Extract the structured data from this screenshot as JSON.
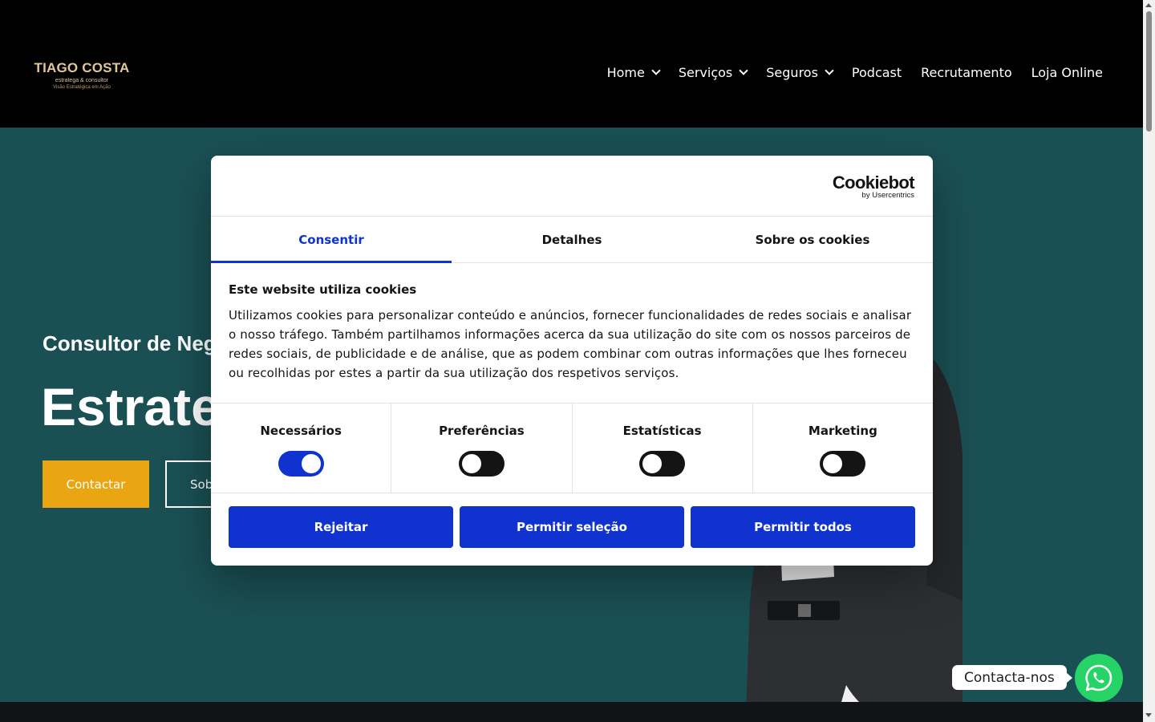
{
  "header": {
    "logo": {
      "name": "TIAGO COSTA",
      "subtitle": "estratega & consultor",
      "tagline": "Visão Estratégica em Ação"
    },
    "nav": [
      {
        "label": "Home",
        "has_dropdown": true
      },
      {
        "label": "Serviços",
        "has_dropdown": true
      },
      {
        "label": "Seguros",
        "has_dropdown": true
      },
      {
        "label": "Podcast",
        "has_dropdown": false
      },
      {
        "label": "Recrutamento",
        "has_dropdown": false
      },
      {
        "label": "Loja Online",
        "has_dropdown": false
      }
    ]
  },
  "hero": {
    "subtitle": "Consultor de Neg",
    "title": "Estrate",
    "contact_button": "Contactar",
    "about_button": "Sob"
  },
  "cookie_dialog": {
    "brand": "Cookiebot",
    "brand_by": "by Usercentrics",
    "tabs": [
      {
        "label": "Consentir",
        "active": true
      },
      {
        "label": "Detalhes",
        "active": false
      },
      {
        "label": "Sobre os cookies",
        "active": false
      }
    ],
    "title": "Este website utiliza cookies",
    "text": "Utilizamos cookies para personalizar conteúdo e anúncios, fornecer funcionalidades de redes sociais e analisar o nosso tráfego. Também partilhamos informações acerca da sua utilização do site com os nossos parceiros de redes sociais, de publicidade e de análise, que as podem combinar com outras informações que lhes forneceu ou recolhidas por estes a partir da sua utilização dos respetivos serviços.",
    "toggles": [
      {
        "label": "Necessários",
        "on": true
      },
      {
        "label": "Preferências",
        "on": false
      },
      {
        "label": "Estatísticas",
        "on": false
      },
      {
        "label": "Marketing",
        "on": false
      }
    ],
    "buttons": {
      "reject": "Rejeitar",
      "allow_selection": "Permitir seleção",
      "allow_all": "Permitir todos"
    }
  },
  "whatsapp": {
    "label": "Contacta-nos"
  },
  "colors": {
    "header_bg": "#000000",
    "hero_bg": "#1a5054",
    "accent_yellow": "#e9a512",
    "cookie_blue": "#1032cf",
    "whatsapp_green": "#25d366"
  },
  "icons": {
    "nav_dropdown": "chevron-down-icon",
    "whatsapp": "whatsapp-icon"
  }
}
